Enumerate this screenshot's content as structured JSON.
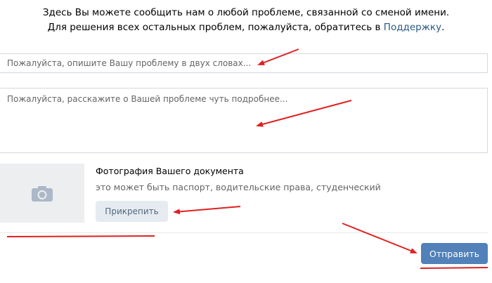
{
  "intro": {
    "line1": "Здесь Вы можете сообщить нам о любой проблеме, связанной со сменой имени.",
    "line2_prefix": "Для решения всех остальных проблем, пожалуйста, обратитесь в ",
    "support_link": "Поддержку",
    "line2_suffix": "."
  },
  "form": {
    "title_placeholder": "Пожалуйста, опишите Вашу проблему в двух словах...",
    "title_value": "",
    "description_placeholder": "Пожалуйста, расскажите о Вашей проблеме чуть подробнее...",
    "description_value": ""
  },
  "document": {
    "title": "Фотография Вашего документа",
    "hint": "это может быть паспорт, водительские права, студенческий",
    "attach_label": "Прикрепить",
    "icon": "camera-icon"
  },
  "actions": {
    "submit_label": "Отправить"
  },
  "colors": {
    "link": "#2a5885",
    "primary_button": "#5181b8",
    "secondary_button": "#e5ebf1",
    "annotation": "#e02020"
  }
}
